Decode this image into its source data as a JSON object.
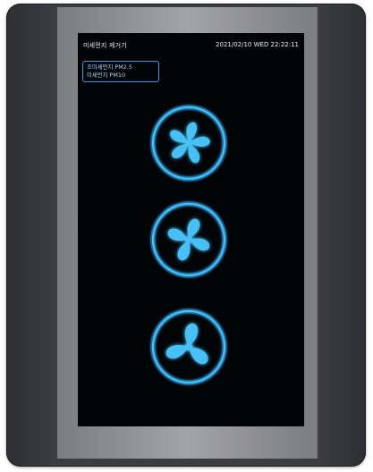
{
  "screen": {
    "title": "미세먼지 제거기",
    "datetime": "2021/02/10 WED 22:22:11"
  },
  "mode_box": {
    "line1": "초미세먼지 PM2.5",
    "line2": "미세먼지 PM10"
  },
  "fans": [
    {
      "name": "fan-1",
      "icon": "fan-icon"
    },
    {
      "name": "fan-2",
      "icon": "fan-icon"
    },
    {
      "name": "fan-3",
      "icon": "fan-icon"
    }
  ],
  "colors": {
    "screen_bg": "#020305",
    "accent_blue": "#2f9ee9",
    "fan_glow": "#37b7ff",
    "text": "#e9eef3"
  }
}
